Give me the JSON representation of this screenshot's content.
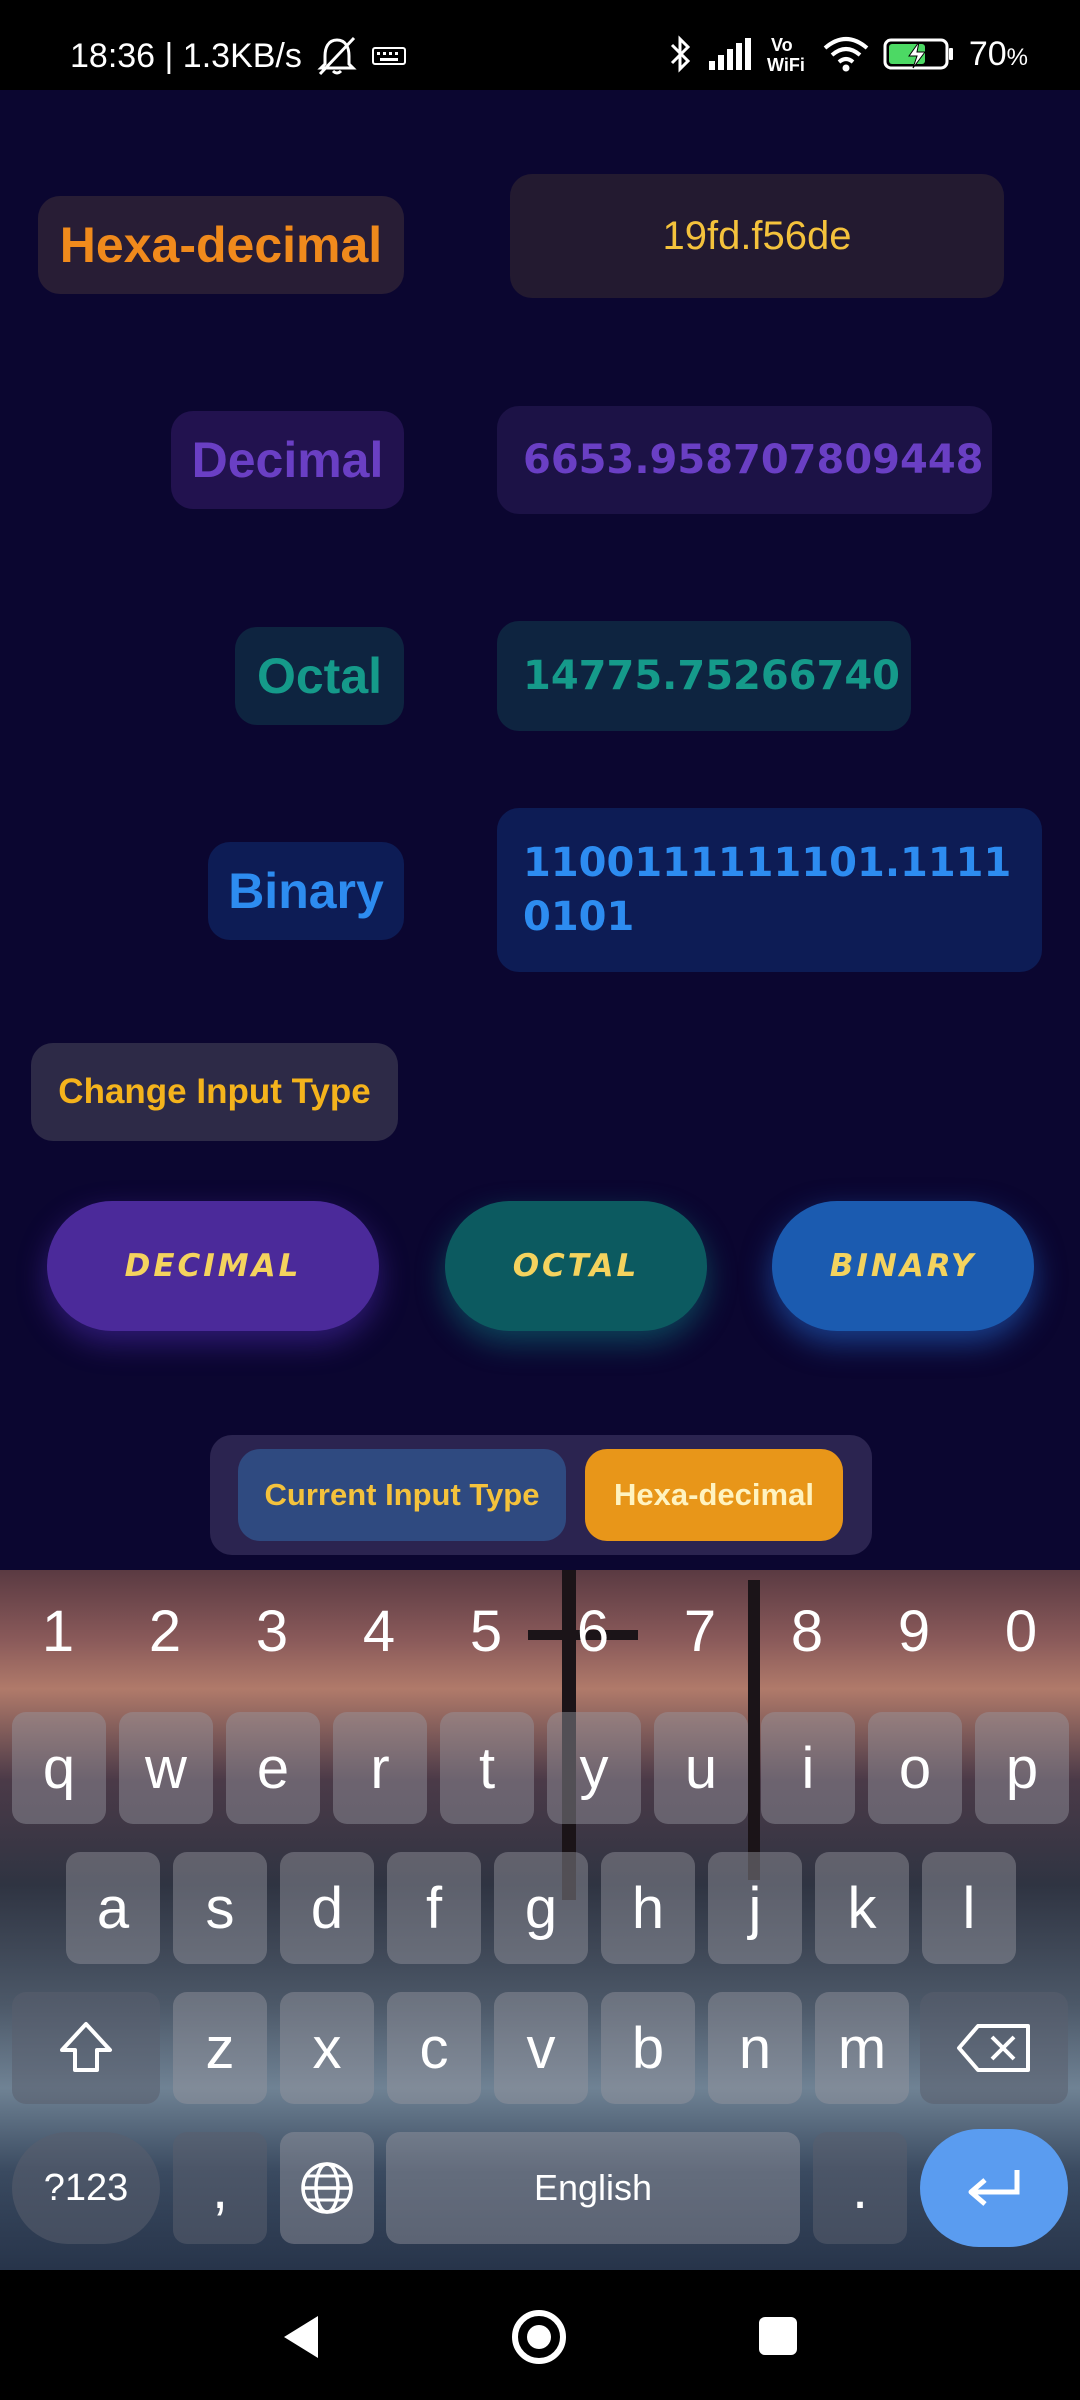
{
  "status_bar": {
    "time_speed": "18:36 | 1.3KB/s",
    "battery_percent": "70",
    "battery_unit": "%"
  },
  "conversions": {
    "hex": {
      "label": "Hexa-decimal",
      "value": "19fd.f56de",
      "color": "#f08a1c"
    },
    "decimal": {
      "label": "Decimal",
      "value": "6653.958707809448",
      "color": "#6a3fc4"
    },
    "octal": {
      "label": "Octal",
      "value": "14775.75266740",
      "color": "#159a8a"
    },
    "binary": {
      "label": "Binary",
      "value_line1": "1100111111101.1111",
      "value_line2": "0101",
      "color": "#2d8cf0"
    }
  },
  "change_input_type": {
    "label": "Change Input Type"
  },
  "type_buttons": [
    {
      "label": "DECIMAL"
    },
    {
      "label": "OCTAL"
    },
    {
      "label": "BINARY"
    }
  ],
  "current_input": {
    "label": "Current Input Type",
    "value": "Hexa-decimal"
  },
  "keyboard": {
    "number_row": [
      "1",
      "2",
      "3",
      "4",
      "5",
      "6",
      "7",
      "8",
      "9",
      "0"
    ],
    "row1": [
      "q",
      "w",
      "e",
      "r",
      "t",
      "y",
      "u",
      "i",
      "o",
      "p"
    ],
    "row2": [
      "a",
      "s",
      "d",
      "f",
      "g",
      "h",
      "j",
      "k",
      "l"
    ],
    "row3": [
      "z",
      "x",
      "c",
      "v",
      "b",
      "n",
      "m"
    ],
    "symbols_key": "?123",
    "comma_key": ",",
    "space_label": "English",
    "period_key": "."
  }
}
